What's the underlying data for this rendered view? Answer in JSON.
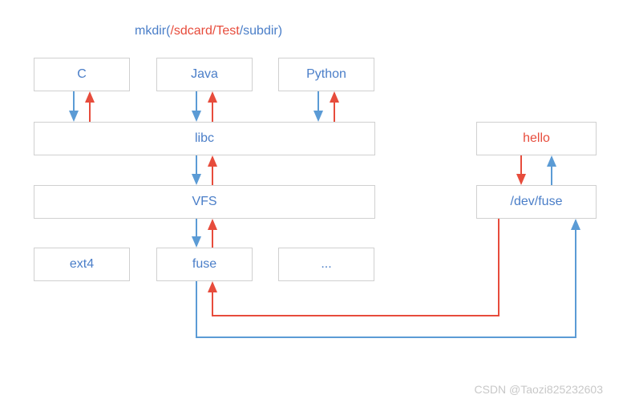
{
  "title": {
    "prefix": "mkdir(",
    "path": "/sdcard/Test",
    "suffix": "/subdir)"
  },
  "nodes": {
    "c": "C",
    "java": "Java",
    "python": "Python",
    "libc": "libc",
    "vfs": "VFS",
    "ext4": "ext4",
    "fuse": "fuse",
    "dots": "...",
    "hello": "hello",
    "devfuse": "/dev/fuse"
  },
  "colors": {
    "blue": "#5b9bd5",
    "red": "#e74c3c",
    "border": "#d0d0d0"
  },
  "watermark": "CSDN @Taozi825232603"
}
